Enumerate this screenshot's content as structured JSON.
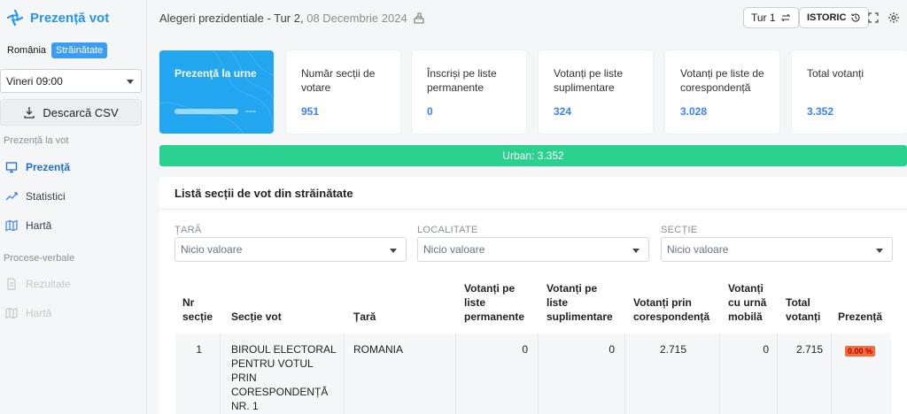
{
  "brand": {
    "title": "Prezență vot"
  },
  "scope": {
    "romania": "România",
    "abroad": "Străinătate"
  },
  "time_select": {
    "value": "Vineri 09:00"
  },
  "csv_button": {
    "label": "Descarcă CSV"
  },
  "sidebar": {
    "section1": "Prezență la vot",
    "items1": [
      {
        "label": "Prezență"
      },
      {
        "label": "Statistici"
      },
      {
        "label": "Hartă"
      }
    ],
    "section2": "Procese-verbale",
    "items2": [
      {
        "label": "Rezultate"
      },
      {
        "label": "Hartă"
      }
    ]
  },
  "header": {
    "title": "Alegeri prezidentiale - Tur 2,",
    "date": "08 Decembrie 2024",
    "round_button": "Tur 1",
    "history_button": "ISTORIC"
  },
  "cards": [
    {
      "label": "Prezență la urne",
      "value": "---"
    },
    {
      "label": "Număr secții de votare",
      "value": "951"
    },
    {
      "label": "Înscriși pe liste permanente",
      "value": "0"
    },
    {
      "label": "Votanți pe liste suplimentare",
      "value": "324"
    },
    {
      "label": "Votanți pe liste de corespondență",
      "value": "3.028"
    },
    {
      "label": "Total votanți",
      "value": "3.352"
    }
  ],
  "urban_bar": {
    "label": "Urban: 3.352"
  },
  "panel": {
    "title": "Listă secții de vot din străinătate",
    "filters": [
      {
        "label": "ȚARĂ",
        "placeholder": "Nicio valoare"
      },
      {
        "label": "LOCALITATE",
        "placeholder": "Nicio valoare"
      },
      {
        "label": "SECȚIE",
        "placeholder": "Nicio valoare"
      }
    ]
  },
  "table": {
    "headers": {
      "nr": "Nr secție",
      "sectie": "Secție vot",
      "tara": "Țară",
      "permanente": "Votanți pe liste permanente",
      "suplimentare": "Votanți pe liste suplimentare",
      "corespondenta": "Votanți prin corespondență",
      "mobila": "Votanți cu urnă mobilă",
      "total": "Total votanți",
      "prezenta": "Prezență"
    },
    "rows": [
      {
        "nr": "1",
        "sectie": "BIROUL ELECTORAL PENTRU VOTUL PRIN CORESPONDENȚĂ NR. 1",
        "tara": "ROMANIA",
        "permanente": "0",
        "suplimentare": "0",
        "corespondenta": "2.715",
        "mobila": "0",
        "total": "2.715",
        "prezenta": "0.00 %"
      }
    ]
  },
  "colors": {
    "accent": "#2196f3",
    "hero": "#23a6f0",
    "urban": "#2bd18e",
    "badge": "#f56e3a"
  }
}
